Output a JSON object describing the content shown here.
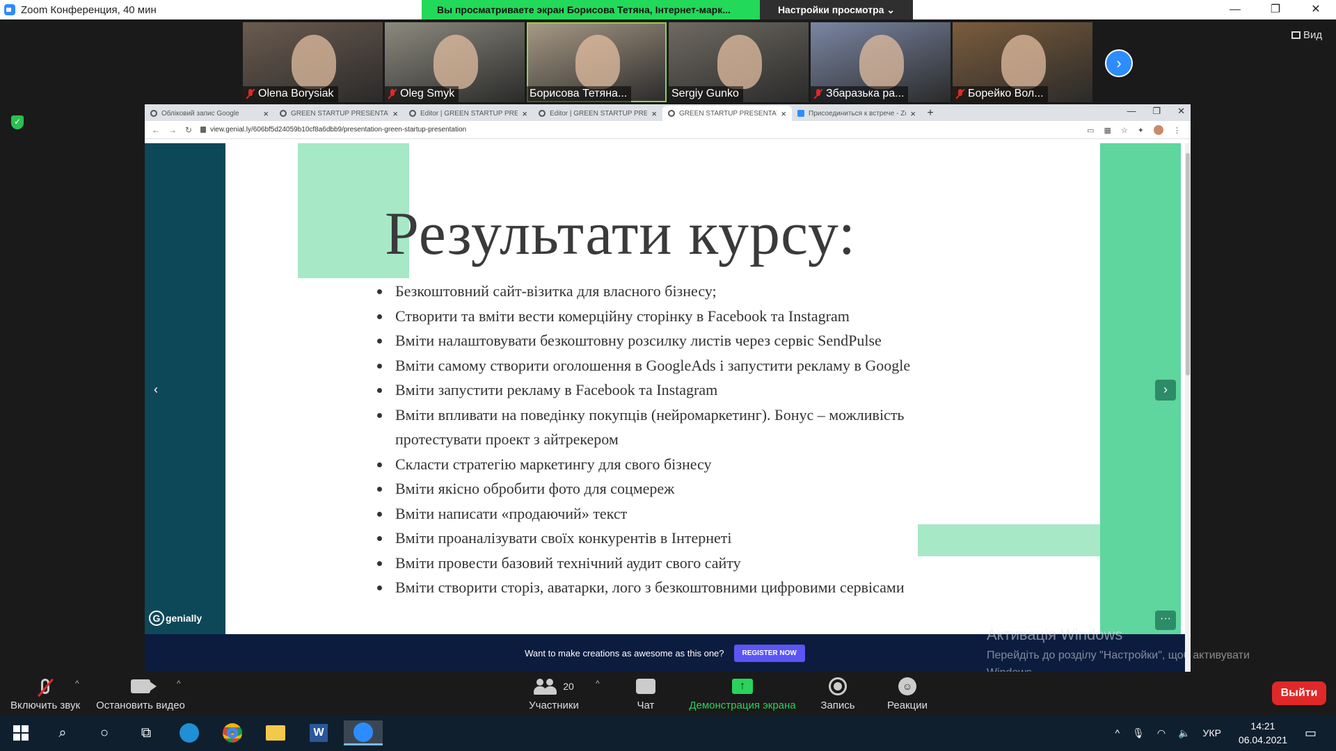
{
  "window": {
    "title": "Zoom Конференция, 40 мин",
    "min": "—",
    "max": "❐",
    "close": "✕"
  },
  "share_banner": {
    "message": "Вы просматриваете экран Борисова Тетяна, Інтернет-марк...",
    "options_label": "Настройки просмотра ⌄"
  },
  "participants": [
    {
      "name": "Olena Borysiak",
      "muted": true,
      "bg": "#6b5b4f"
    },
    {
      "name": "Oleg Smyk",
      "muted": true,
      "bg": "#8c8a7e"
    },
    {
      "name": "Борисова Тетяна...",
      "muted": false,
      "bg": "#a89a86",
      "active": true
    },
    {
      "name": "Sergiy Gunko",
      "muted": false,
      "bg": "#6f6a62"
    },
    {
      "name": "Збаразька ра...",
      "muted": true,
      "bg": "#7a86a3"
    },
    {
      "name": "Борейко Вол...",
      "muted": true,
      "bg": "#7b5c3c"
    }
  ],
  "view_label": "Вид",
  "browser": {
    "tabs": [
      {
        "title": "Обліковий запис Google",
        "icon": "google-icon"
      },
      {
        "title": "GREEN STARTUP PRESENTATION",
        "icon": "genially-icon"
      },
      {
        "title": "Editor | GREEN STARTUP PRESEN",
        "icon": "genially-icon"
      },
      {
        "title": "Editor | GREEN STARTUP PRESEN",
        "icon": "genially-icon"
      },
      {
        "title": "GREEN STARTUP PRESENTATION",
        "icon": "genially-icon",
        "active": true
      },
      {
        "title": "Присоединиться к встрече - Zo",
        "icon": "zoom-icon"
      }
    ],
    "url": "view.genial.ly/606bf5d24059b10cf8a6dbb9/presentation-green-startup-presentation"
  },
  "slide": {
    "title": "Результати курсу:",
    "bullets": [
      "Безкоштовний сайт-візитка для власного бізнесу;",
      "Створити та вміти вести комерційну сторінку в Facebook та Instagram",
      "Вміти налаштовувати безкоштовну розсилку листів через сервіс SendPulse",
      "Вміти самому створити оголошення в GoogleAds і запустити рекламу в Google",
      "Вміти запустити рекламу в Facebook та Instagram",
      "Вміти впливати на поведінку покупців (нейромаркетинг). Бонус – можливість протестувати проект з айтрекером",
      "Скласти стратегію маркетингу для свого бізнесу",
      "Вміти якісно обробити фото для соцмереж",
      "Вміти написати «продаючий» текст",
      "Вміти проаналізувати своїх конкурентів в Інтернеті",
      "Вміти провести базовий технічний аудит свого сайту",
      "Вміти створити сторіз, аватарки, лого з безкоштовними цифровими сервісами"
    ],
    "logo_text": "genially"
  },
  "promo": {
    "text": "Want to make creations as awesome as this one?",
    "button": "REGISTER NOW"
  },
  "activation": {
    "heading": "Активація Windows",
    "subtext": "Перейдіть до розділу \"Настройки\", щоб активувати Windows."
  },
  "toolbar": {
    "mute_label": "Включить звук",
    "video_label": "Остановить видео",
    "participants_label": "Участники",
    "participants_count": "20",
    "chat_label": "Чат",
    "share_label": "Демонстрация экрана",
    "record_label": "Запись",
    "reactions_label": "Реакции",
    "leave_label": "Выйти"
  },
  "taskbar": {
    "lang": "УКР",
    "time": "14:21",
    "date": "06.04.2021"
  },
  "colors": {
    "zoom_blue": "#2d8cff",
    "share_green": "#23d959",
    "leave_red": "#e02828",
    "slide_dark": "#0d4858",
    "slide_green": "#5ed69e"
  }
}
